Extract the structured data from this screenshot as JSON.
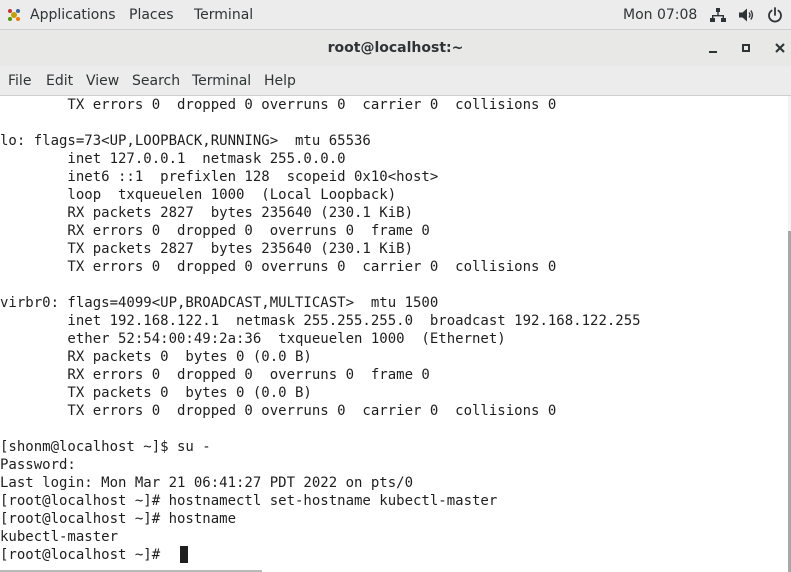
{
  "topbar": {
    "applications": "Applications",
    "places": "Places",
    "terminal": "Terminal",
    "clock": "Mon 07:08",
    "icons": [
      "network-icon",
      "volume-icon",
      "power-icon"
    ]
  },
  "window": {
    "title": "root@localhost:~"
  },
  "menubar": {
    "items": [
      "File",
      "Edit",
      "View",
      "Search",
      "Terminal",
      "Help"
    ]
  },
  "terminal": {
    "lines": [
      "        TX errors 0  dropped 0 overruns 0  carrier 0  collisions 0",
      "",
      "lo: flags=73<UP,LOOPBACK,RUNNING>  mtu 65536",
      "        inet 127.0.0.1  netmask 255.0.0.0",
      "        inet6 ::1  prefixlen 128  scopeid 0x10<host>",
      "        loop  txqueuelen 1000  (Local Loopback)",
      "        RX packets 2827  bytes 235640 (230.1 KiB)",
      "        RX errors 0  dropped 0  overruns 0  frame 0",
      "        TX packets 2827  bytes 235640 (230.1 KiB)",
      "        TX errors 0  dropped 0 overruns 0  carrier 0  collisions 0",
      "",
      "virbr0: flags=4099<UP,BROADCAST,MULTICAST>  mtu 1500",
      "        inet 192.168.122.1  netmask 255.255.255.0  broadcast 192.168.122.255",
      "        ether 52:54:00:49:2a:36  txqueuelen 1000  (Ethernet)",
      "        RX packets 0  bytes 0 (0.0 B)",
      "        RX errors 0  dropped 0  overruns 0  frame 0",
      "        TX packets 0  bytes 0 (0.0 B)",
      "        TX errors 0  dropped 0 overruns 0  carrier 0  collisions 0",
      "",
      "[shonm@localhost ~]$ su -",
      "Password:",
      "Last login: Mon Mar 21 06:41:27 PDT 2022 on pts/0",
      "[root@localhost ~]# hostnamectl set-hostname kubectl-master",
      "[root@localhost ~]# hostname",
      "kubectl-master",
      "[root@localhost ~]# "
    ]
  }
}
